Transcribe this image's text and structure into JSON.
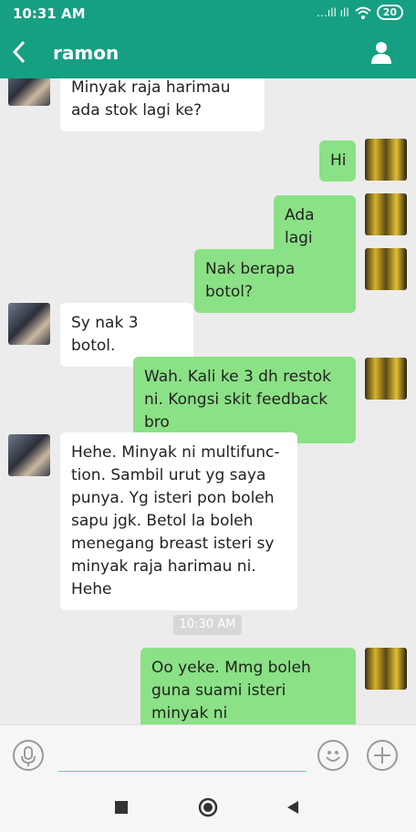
{
  "status_bar": {
    "time": "10:31 AM",
    "battery": "20",
    "signal_text": "…ıll ıll"
  },
  "header": {
    "contact_name": "ramon",
    "back_icon": "chevron-left-icon",
    "profile_icon": "person-icon"
  },
  "messages": [
    {
      "side": "in",
      "text": "Minyak raja harimau ada stok lagi ke?"
    },
    {
      "side": "out",
      "text": "Hi"
    },
    {
      "side": "out",
      "text": "Ada lagi"
    },
    {
      "side": "out",
      "text": "Nak berapa botol?"
    },
    {
      "side": "in",
      "text": "Sy nak 3 botol."
    },
    {
      "side": "out",
      "text": "Wah. Kali ke 3 dh restok ni. Kongsi skit feedback bro"
    },
    {
      "side": "in",
      "text": "Hehe. Minyak ni multifunc-tion. Sambil urut yg saya punya. Yg isteri pon boleh sapu jgk. Betol la boleh menegang breast isteri sy minyak raja harimau ni. Hehe"
    },
    {
      "side": "out",
      "text": "Oo yeke. Mmg boleh guna suami isteri minyak ni"
    }
  ],
  "time_divider": "10:30 AM",
  "input": {
    "value": "",
    "placeholder": ""
  },
  "colors": {
    "header": "#15a083",
    "outgoing_bubble": "#8be185",
    "incoming_bubble": "#ffffff",
    "background": "#ececec"
  }
}
